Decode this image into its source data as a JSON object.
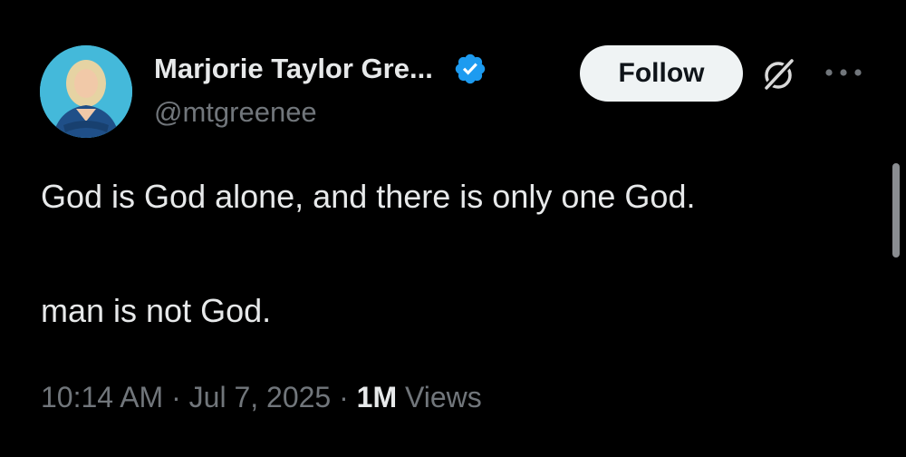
{
  "author": {
    "display_name": "Marjorie Taylor Gre...",
    "handle": "@mtgreenee",
    "verified": true,
    "verified_color": "#1d9bf0"
  },
  "actions": {
    "follow_label": "Follow",
    "grok_icon": "grok-icon",
    "more_icon": "more-options-icon"
  },
  "tweet": {
    "lines": [
      "God is God alone, and there is only one God.",
      "man is not God."
    ]
  },
  "meta": {
    "time": "10:14 AM",
    "separator": "·",
    "date": "Jul 7, 2025",
    "views_count": "1M",
    "views_label": "Views"
  },
  "colors": {
    "background": "#000000",
    "primary_text": "#e7e9ea",
    "secondary_text": "#71767b",
    "follow_bg": "#eff3f4"
  }
}
